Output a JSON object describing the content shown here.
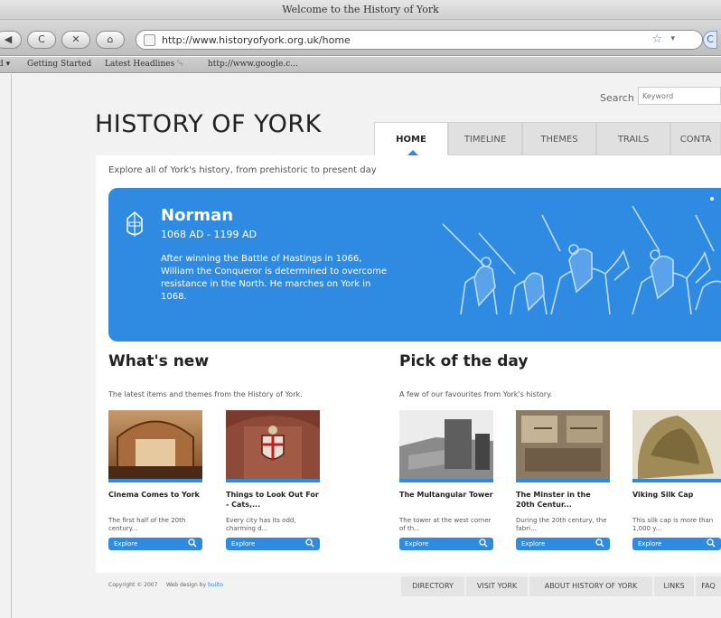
{
  "browser": {
    "window_title": "Welcome to the History of York",
    "url": "http://www.historyofyork.org.uk/home",
    "bookmarks": [
      "d ▾",
      "Getting Started",
      "Latest Headlines ␄",
      "http://www.google.c..."
    ],
    "nav_back": "◀",
    "nav_reload": "C",
    "nav_stop": "✕",
    "nav_home": "⌂",
    "star": "☆",
    "dropdown": "▾",
    "right_btn": "C"
  },
  "site": {
    "logo": "HISTORY OF YORK",
    "search_label": "Search",
    "search_placeholder": "Keyword",
    "tabs": [
      "HOME",
      "TIMELINE",
      "THEMES",
      "TRAILS",
      "CONTA"
    ],
    "tagline": "Explore all of York's history, from prehistoric to present day"
  },
  "hero": {
    "era": "Norman",
    "dates": "1068 AD - 1199 AD",
    "description": "After winning the Battle of Hastings in 1066, William the Conqueror is determined to overcome resistance in the North. He marches on York in 1068."
  },
  "whats_new": {
    "title": "What's new",
    "subtitle": "The latest items and themes from the History of York.",
    "cards": [
      {
        "title": "Cinema Comes to York",
        "desc": "The first half of the 20th century...",
        "button": "Explore"
      },
      {
        "title": "Things to Look Out For - Cats,...",
        "desc": "Every city has its odd, charming d...",
        "button": "Explore"
      }
    ]
  },
  "pick_of_day": {
    "title": "Pick of the day",
    "subtitle": "A few of our favourites from York's history.",
    "cards": [
      {
        "title": "The Multangular Tower",
        "desc": "The tower at the west corner of th...",
        "button": "Explore"
      },
      {
        "title": "The Minster in the 20th Centur...",
        "desc": "During the 20th century, the fabri...",
        "button": "Explore"
      },
      {
        "title": "Viking Silk Cap",
        "desc": "This silk cap is more than 1,000 y...",
        "button": "Explore"
      }
    ]
  },
  "footer": {
    "copyright": "Copyright © 2007",
    "webdesign": "Web design by",
    "designer": "builto",
    "links": [
      "DIRECTORY",
      "VISIT YORK",
      "ABOUT HISTORY OF YORK",
      "LINKS",
      "FAQ"
    ]
  },
  "colors": {
    "accent": "#2e8be1",
    "page_bg": "#f2f2f2"
  }
}
